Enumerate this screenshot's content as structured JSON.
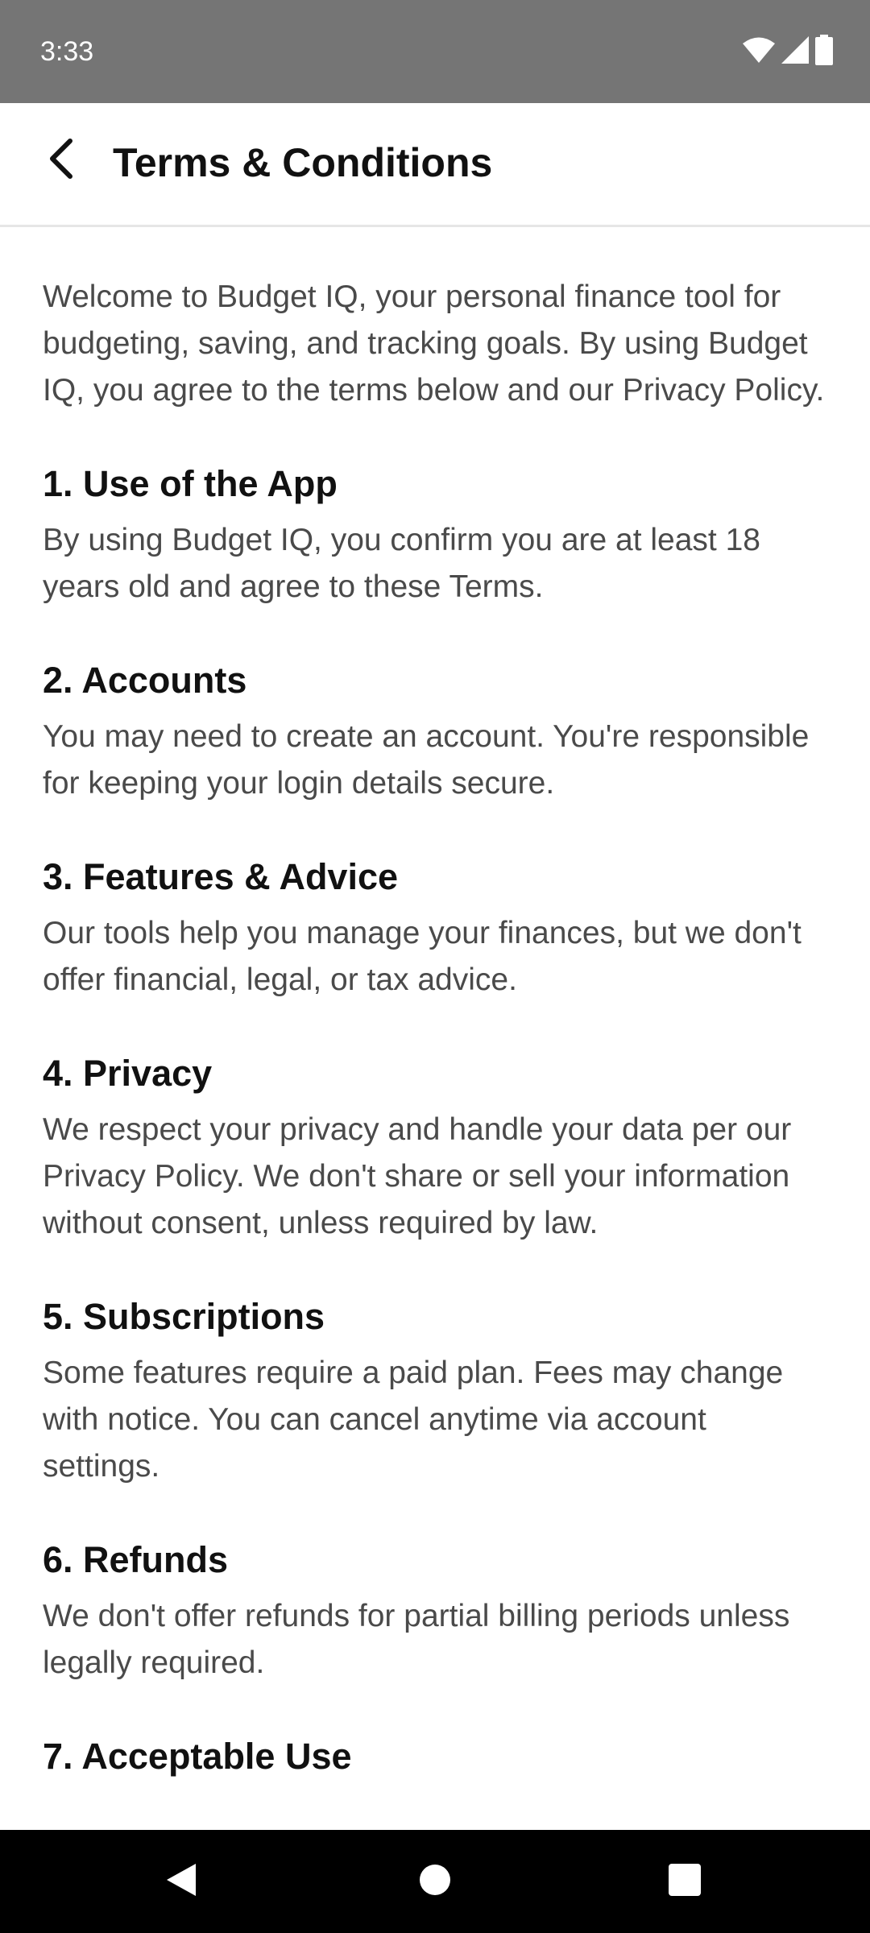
{
  "status_bar": {
    "time": "3:33",
    "icons": [
      "wifi-icon",
      "cellular-signal-icon",
      "battery-icon"
    ]
  },
  "header": {
    "title": "Terms & Conditions",
    "back_icon": "chevron-left-icon"
  },
  "content": {
    "intro": "Welcome to Budget IQ, your personal finance tool for budgeting, saving, and tracking goals. By using Budget IQ, you agree to the terms below and our Privacy Policy.",
    "sections": [
      {
        "title": "1. Use of the App",
        "body": "By using Budget IQ, you confirm you are at least 18 years old and agree to these Terms."
      },
      {
        "title": "2. Accounts",
        "body": "You may need to create an account. You're responsible for keeping your login details secure."
      },
      {
        "title": "3. Features & Advice",
        "body": "Our tools help you manage your finances, but we don't offer financial, legal, or tax advice."
      },
      {
        "title": "4. Privacy",
        "body": "We respect your privacy and handle your data per our Privacy Policy. We don't share or sell your information without consent, unless required by law."
      },
      {
        "title": "5. Subscriptions",
        "body": "Some features require a paid plan. Fees may change with notice. You can cancel anytime via account settings."
      },
      {
        "title": "6. Refunds",
        "body": "We don't offer refunds for partial billing periods unless legally required."
      },
      {
        "title": "7. Acceptable Use",
        "body": ""
      }
    ]
  },
  "nav_bar": {
    "icons": [
      "nav-back-icon",
      "nav-home-icon",
      "nav-recents-icon"
    ]
  },
  "colors": {
    "status_bar_bg": "#757575",
    "header_title": "#111111",
    "body_text": "#4a4a4a",
    "nav_bar_bg": "#000000"
  }
}
